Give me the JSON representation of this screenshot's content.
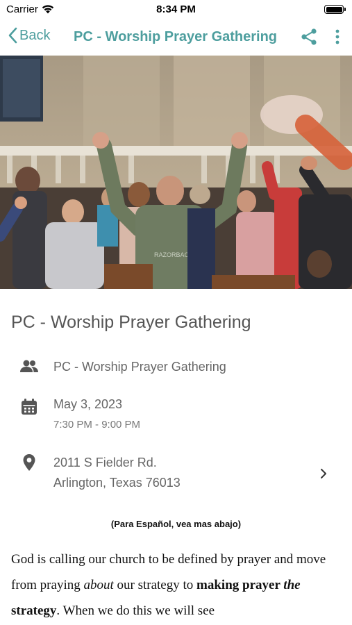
{
  "status": {
    "carrier": "Carrier",
    "time": "8:34 PM"
  },
  "nav": {
    "back_label": "Back",
    "title": "PC - Worship Prayer Gathering"
  },
  "event": {
    "title": "PC - Worship Prayer Gathering",
    "group": "PC - Worship Prayer Gathering",
    "date": "May 3, 2023",
    "time_range": "7:30 PM - 9:00 PM",
    "address_line1": "2011 S Fielder Rd.",
    "address_line2": "Arlington, Texas 76013"
  },
  "spanish_note": "(Para Español, vea mas abajo)",
  "description": {
    "p1_a": "God is calling our church to be defined by prayer and move from praying ",
    "p1_about": "about",
    "p1_b": " our strategy to ",
    "p1_making": "making prayer ",
    "p1_the": "the",
    "p1_strategy": " strategy",
    "p1_c": ". When we do this we will see"
  },
  "colors": {
    "accent": "#4d9e9e",
    "icon": "#555555"
  },
  "icons": {
    "wifi": "wifi-icon",
    "battery": "battery-icon",
    "back": "chevron-left-icon",
    "share": "share-icon",
    "more": "more-vertical-icon",
    "group": "people-icon",
    "calendar": "calendar-icon",
    "location": "map-pin-icon",
    "chevron": "chevron-right-icon"
  }
}
